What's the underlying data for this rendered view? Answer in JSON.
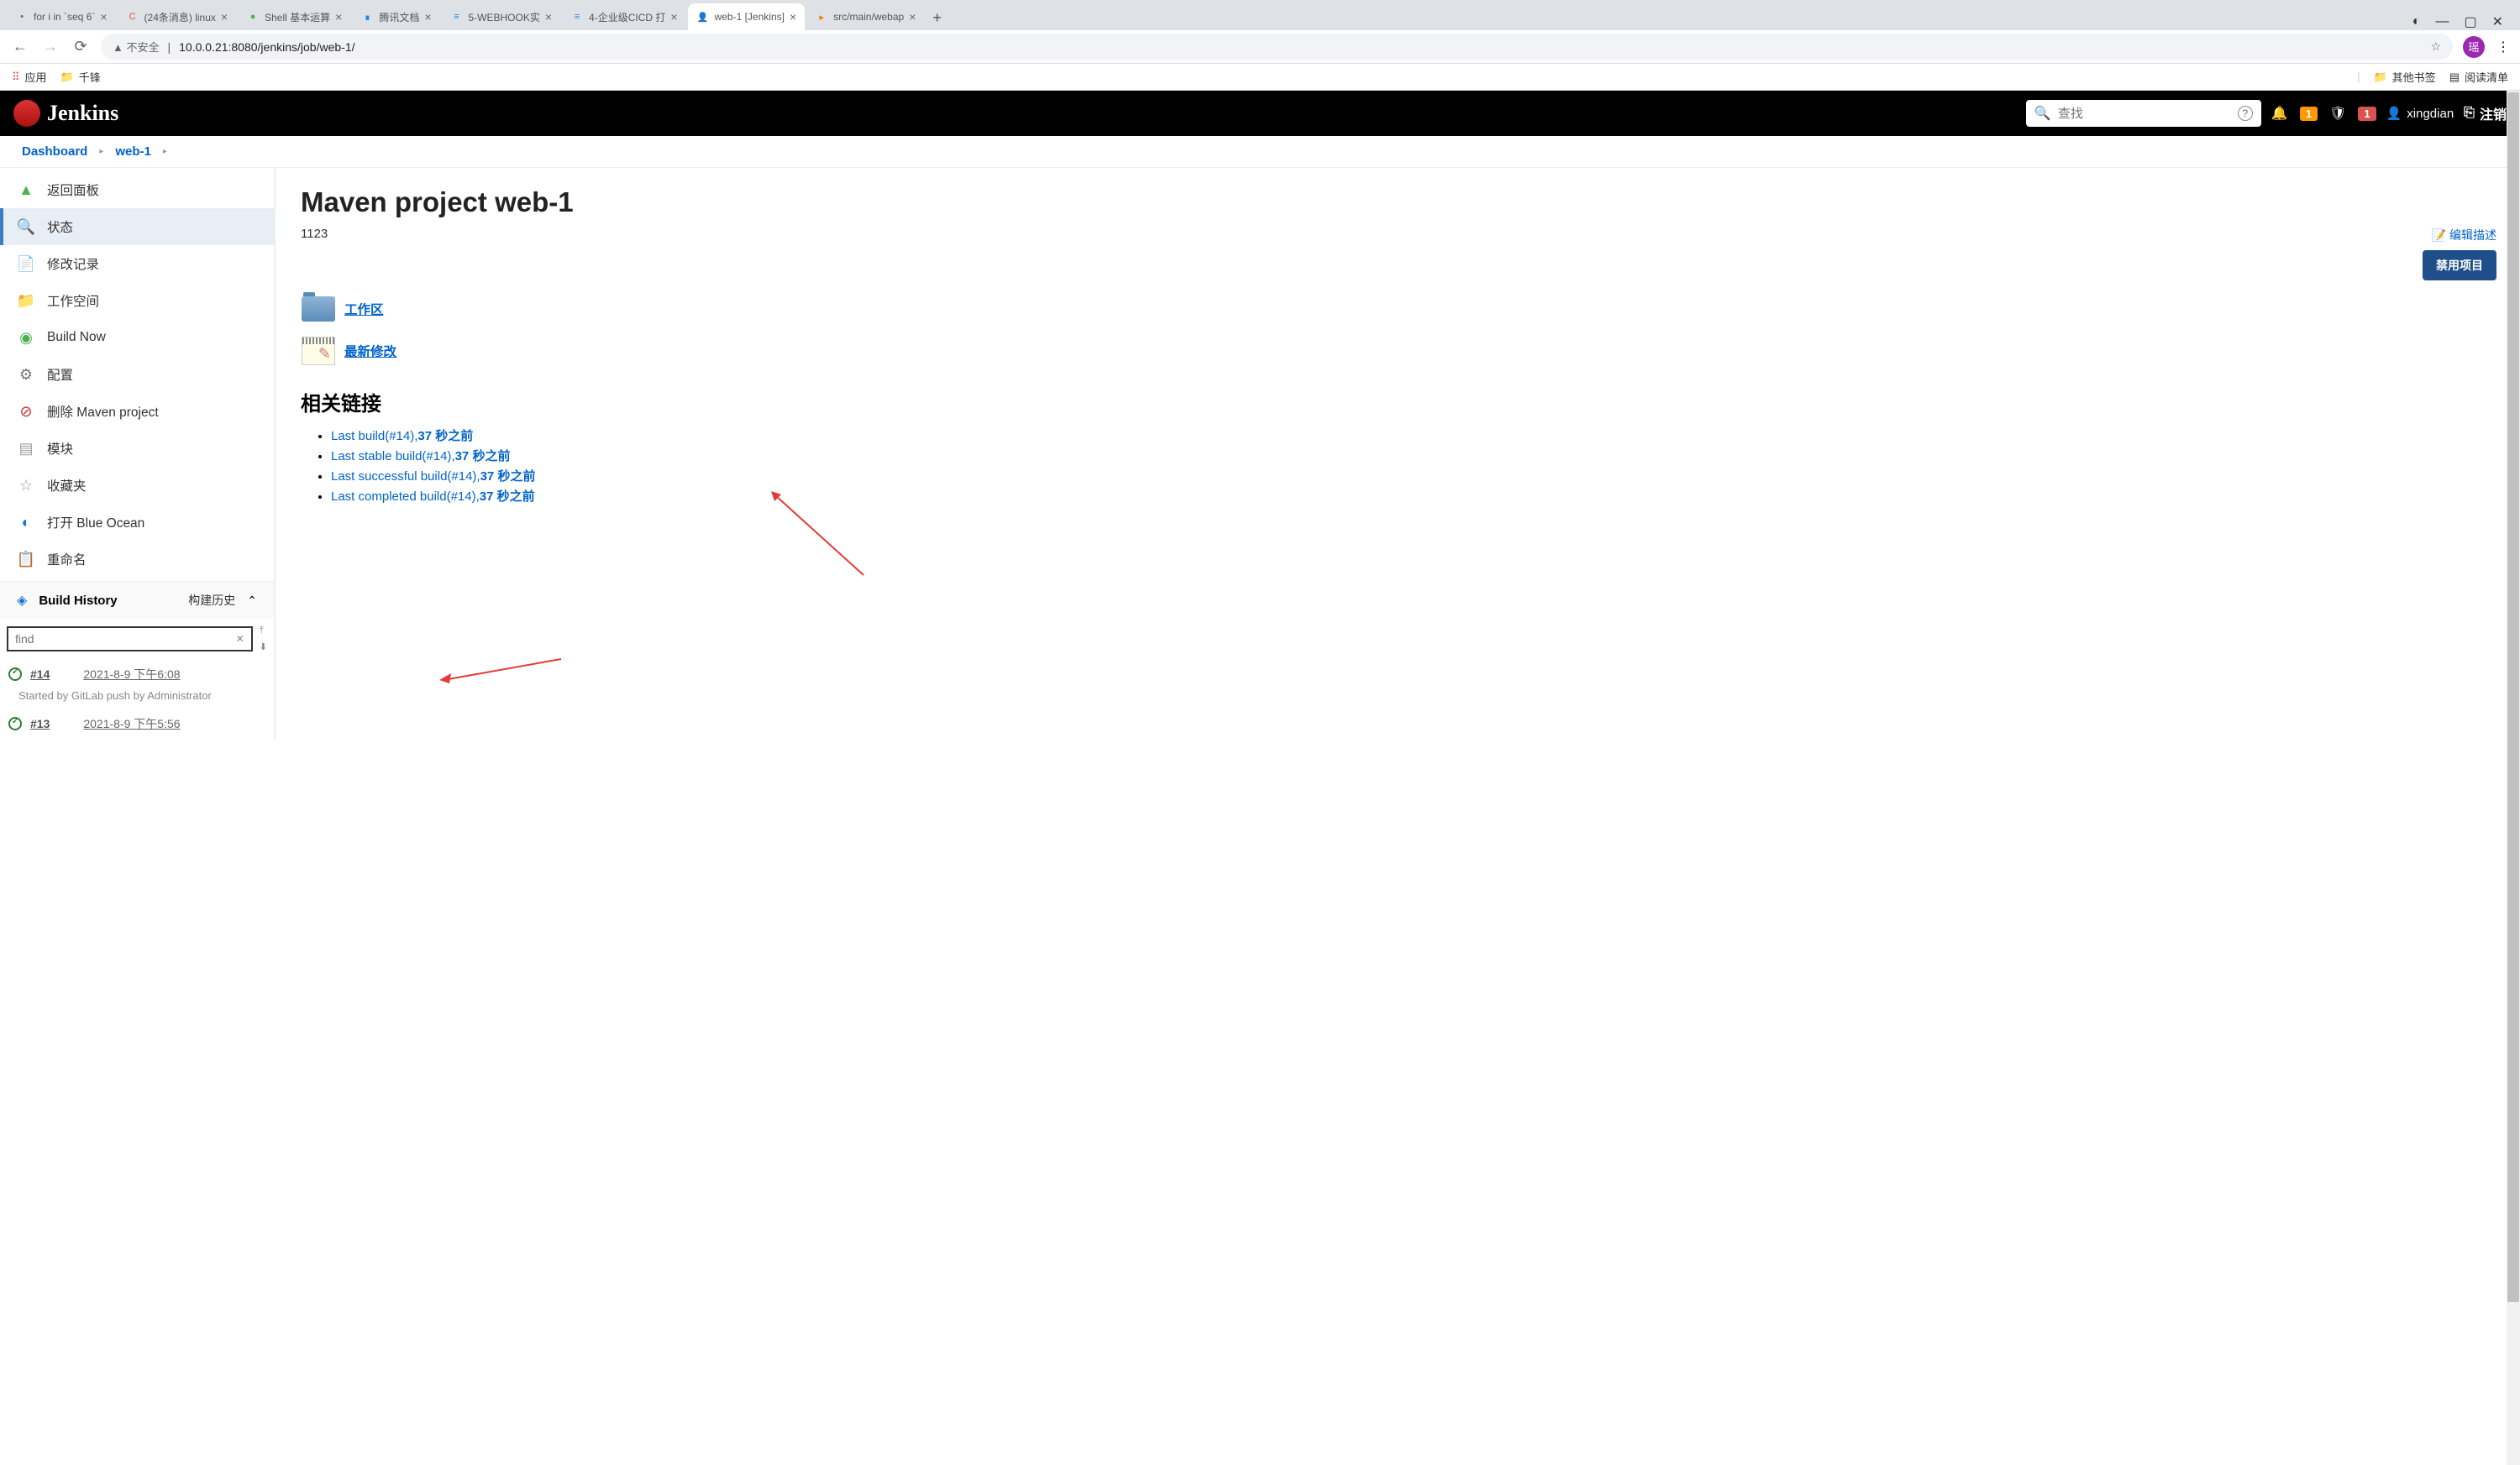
{
  "browser": {
    "tabs": [
      {
        "favicon": "",
        "title": "for i in `seq 6`"
      },
      {
        "favicon": "C",
        "title": "(24条消息) linux",
        "faviconColor": "#e74c3c"
      },
      {
        "favicon": "●",
        "title": "Shell 基本运算",
        "faviconColor": "#4caf50"
      },
      {
        "favicon": "∎",
        "title": "腾讯文档",
        "faviconColor": "#1e88e5"
      },
      {
        "favicon": "≡",
        "title": "5-WEBHOOK实",
        "faviconColor": "#1e88e5"
      },
      {
        "favicon": "≡",
        "title": "4-企业级CICD 打",
        "faviconColor": "#1e88e5"
      },
      {
        "favicon": "👤",
        "title": "web-1 [Jenkins]",
        "active": true
      },
      {
        "favicon": "▸",
        "title": "src/main/webap",
        "faviconColor": "#f57c00"
      }
    ],
    "addTab": "+",
    "navBack": "←",
    "navFwd": "→",
    "reload": "⟳",
    "secWarn": "▲ 不安全",
    "url": "10.0.0.21:8080/jenkins/job/web-1/",
    "star": "☆",
    "profile": "瑶",
    "menu": "⋮",
    "bookmarks": {
      "apps": "应用",
      "app1": "千锋",
      "other": "其他书签",
      "reading": "阅读清单"
    }
  },
  "header": {
    "brand": "Jenkins",
    "searchPlaceholder": "查找",
    "help": "?",
    "badge1": "1",
    "badge2": "1",
    "user": "xingdian",
    "logout": "注销"
  },
  "breadcrumb": {
    "dashboard": "Dashboard",
    "job": "web-1"
  },
  "sidebar": {
    "items": [
      {
        "icon": "▲",
        "label": "返回面板",
        "color": "#4caf50"
      },
      {
        "icon": "🔍",
        "label": "状态",
        "active": true,
        "color": "#888"
      },
      {
        "icon": "📄",
        "label": "修改记录",
        "color": "#9e9e9e"
      },
      {
        "icon": "📁",
        "label": "工作空间",
        "color": "#607d8b"
      },
      {
        "icon": "◉",
        "label": "Build Now",
        "color": "#4caf50"
      },
      {
        "icon": "⚙",
        "label": "配置",
        "color": "#757575"
      },
      {
        "icon": "⊘",
        "label": "删除 Maven project",
        "color": "#d32f2f"
      },
      {
        "icon": "▤",
        "label": "模块",
        "color": "#9e9e9e"
      },
      {
        "icon": "☆",
        "label": "收藏夹",
        "color": "#999"
      },
      {
        "icon": "◐",
        "label": "打开 Blue Ocean",
        "color": "#1976d2"
      },
      {
        "icon": "📋",
        "label": "重命名",
        "color": "#9e9e9e"
      }
    ]
  },
  "buildHistory": {
    "title": "Build History",
    "label": "构建历史",
    "findPlaceholder": "find",
    "builds": [
      {
        "num": "#14",
        "ts": "2021-8-9 下午6:08",
        "cause": "Started by GitLab push by Administrator"
      },
      {
        "num": "#13",
        "ts": "2021-8-9 下午5:56"
      }
    ]
  },
  "main": {
    "title": "Maven project web-1",
    "desc": "1123",
    "editDesc": "编辑描述",
    "disable": "禁用项目",
    "workspaceLink": "工作区",
    "changesLink": "最新修改",
    "relatedTitle": "相关链接",
    "links": [
      {
        "pre": "Last build(#14),",
        "bold": "37 秒之前"
      },
      {
        "pre": "Last stable build(#14),",
        "bold": "37 秒之前"
      },
      {
        "pre": "Last successful build(#14),",
        "bold": "37 秒之前"
      },
      {
        "pre": "Last completed build(#14),",
        "bold": "37 秒之前"
      }
    ]
  }
}
